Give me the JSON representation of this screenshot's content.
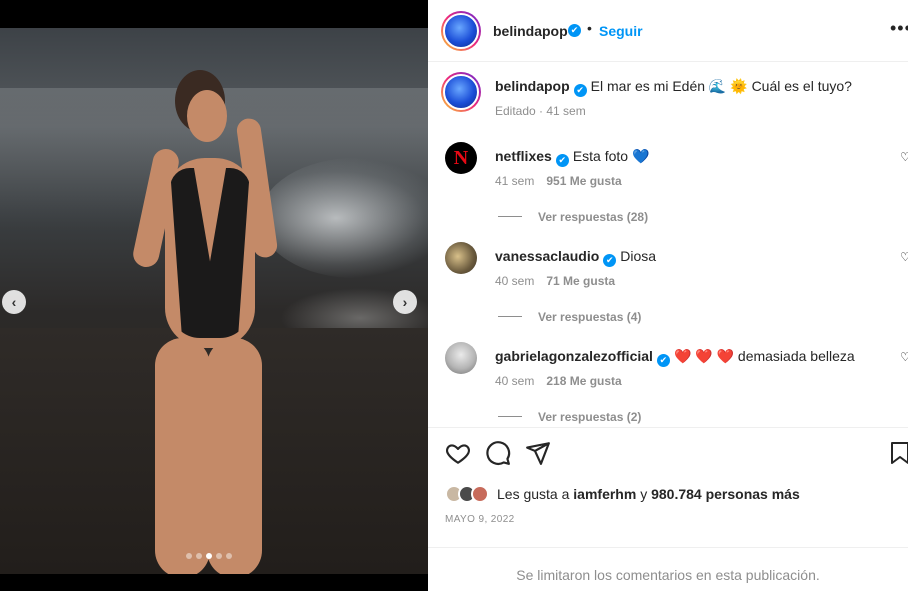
{
  "post": {
    "username": "belindapop",
    "verified_mark": "✔",
    "separator": "•",
    "follow_label": "Seguir",
    "more_label": "•••",
    "caption": {
      "text": "El mar es mi Edén 🌊 🌞 Cuál es el tuyo?",
      "edited": "Editado",
      "time": "41 sem"
    },
    "carousel": {
      "total": 5,
      "active_index": 2,
      "prev_icon": "chevron-left-icon",
      "next_icon": "chevron-right-icon"
    }
  },
  "comments": [
    {
      "username": "netflixes",
      "text": "Esta foto 💙",
      "time": "41 sem",
      "likes": "951 Me gusta",
      "replies": "Ver respuestas (28)",
      "avatar_letter": "N"
    },
    {
      "username": "vanessaclaudio",
      "text": "Diosa",
      "time": "40 sem",
      "likes": "71 Me gusta",
      "replies": "Ver respuestas (4)"
    },
    {
      "username": "gabrielagonzalezofficial",
      "text": "❤️ ❤️ ❤️ demasiada belleza",
      "time": "40 sem",
      "likes": "218 Me gusta",
      "replies": "Ver respuestas (2)"
    }
  ],
  "actions": {
    "like_icon": "heart-icon",
    "comment_icon": "comment-icon",
    "share_icon": "send-icon",
    "save_icon": "bookmark-icon"
  },
  "likes": {
    "prefix": "Les gusta a",
    "user": "iamferhm",
    "middle": "y",
    "count": "980.784 personas más"
  },
  "date": "MAYO 9, 2022",
  "comments_limited": "Se limitaron los comentarios en esta publicación.",
  "colors": {
    "accent": "#0095f6",
    "text": "#262626",
    "muted": "#8e8e8e"
  }
}
